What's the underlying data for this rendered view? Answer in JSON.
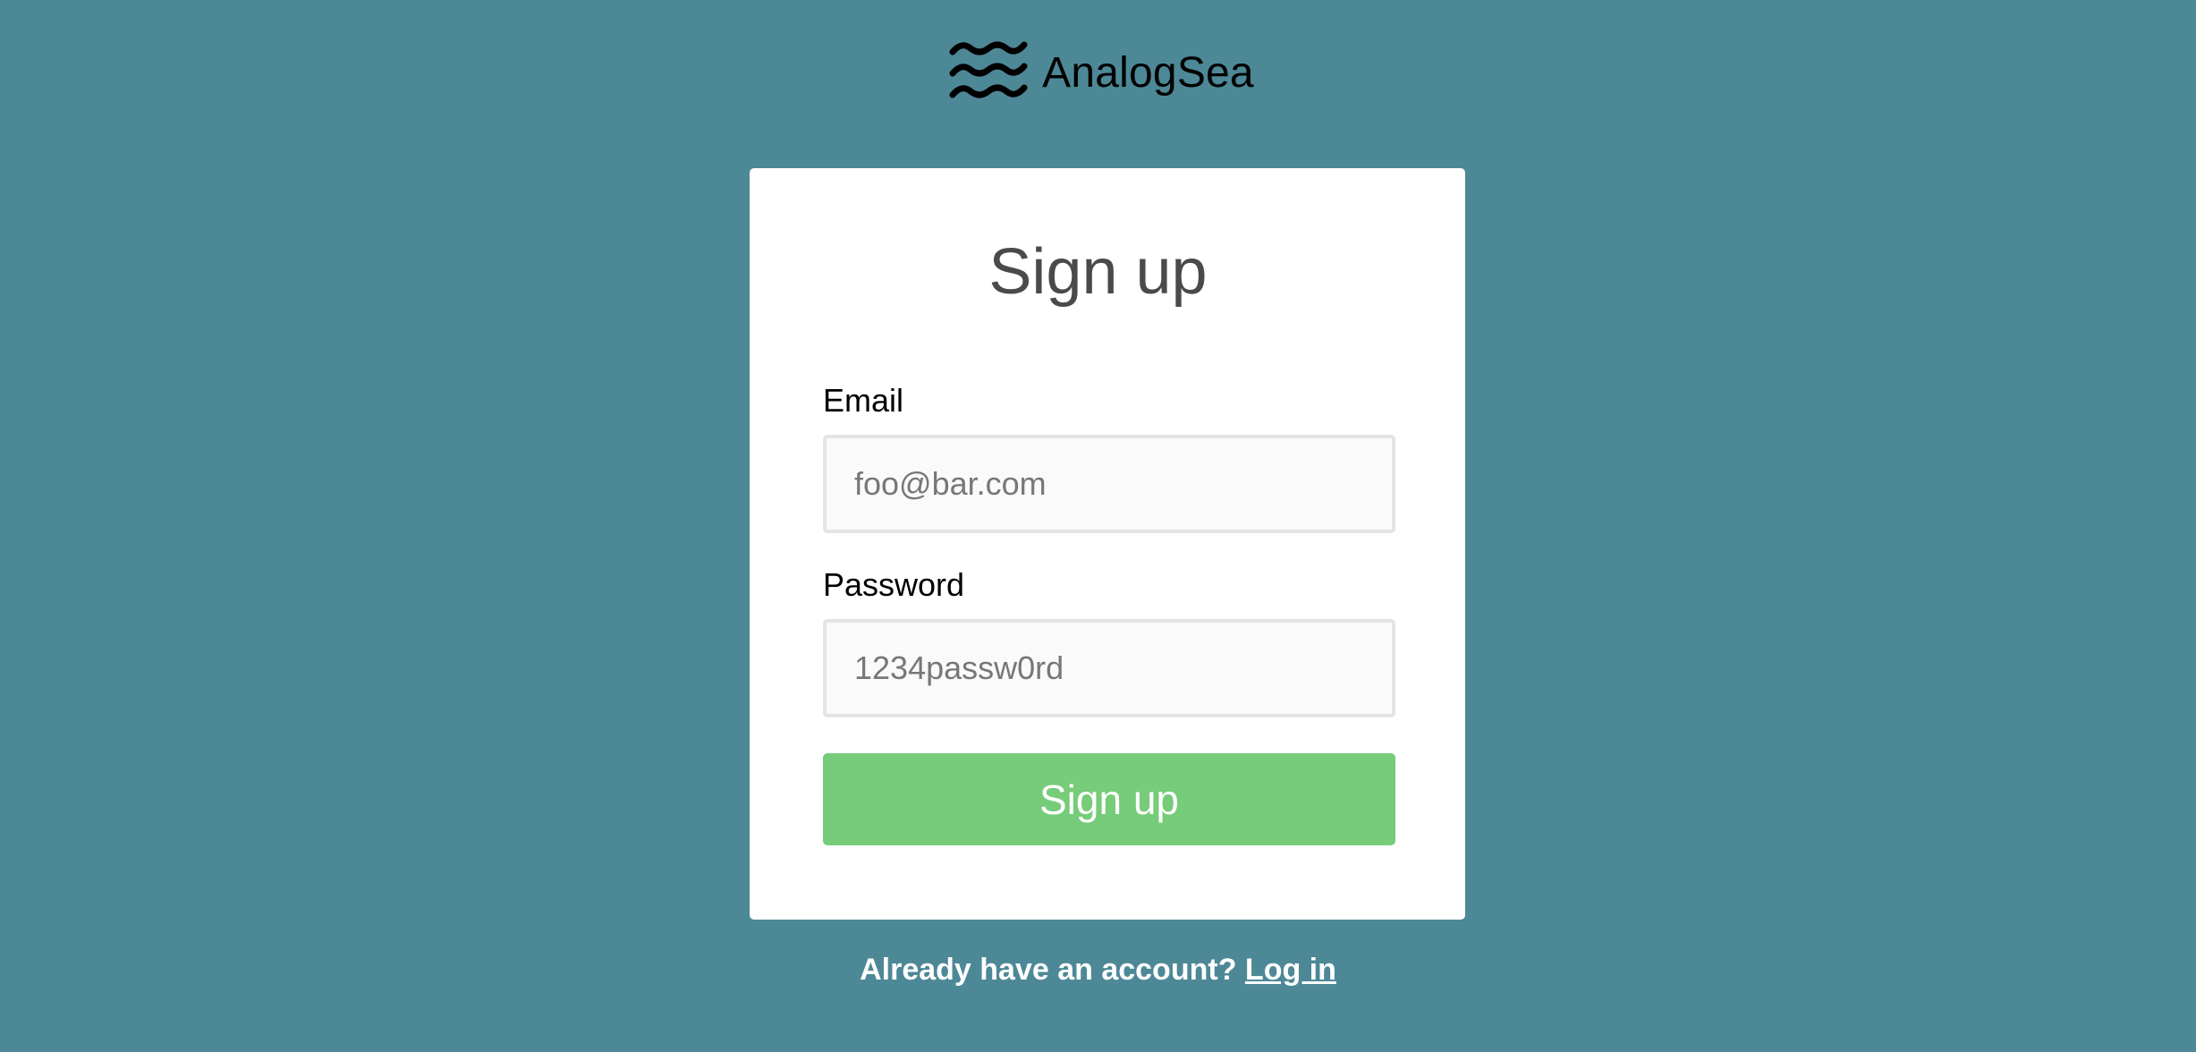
{
  "brand": {
    "name": "AnalogSea",
    "icon": "waves-icon"
  },
  "form": {
    "title": "Sign up",
    "email_label": "Email",
    "email_placeholder": "foo@bar.com",
    "email_value": "",
    "password_label": "Password",
    "password_placeholder": "1234passw0rd",
    "password_value": "",
    "submit_label": "Sign up"
  },
  "footer": {
    "prompt": "Already have an account?",
    "login_link": "Log in"
  },
  "colors": {
    "background": "#4d8897",
    "card": "#ffffff",
    "button": "#76cc78",
    "title_text": "#4a4a4a"
  }
}
